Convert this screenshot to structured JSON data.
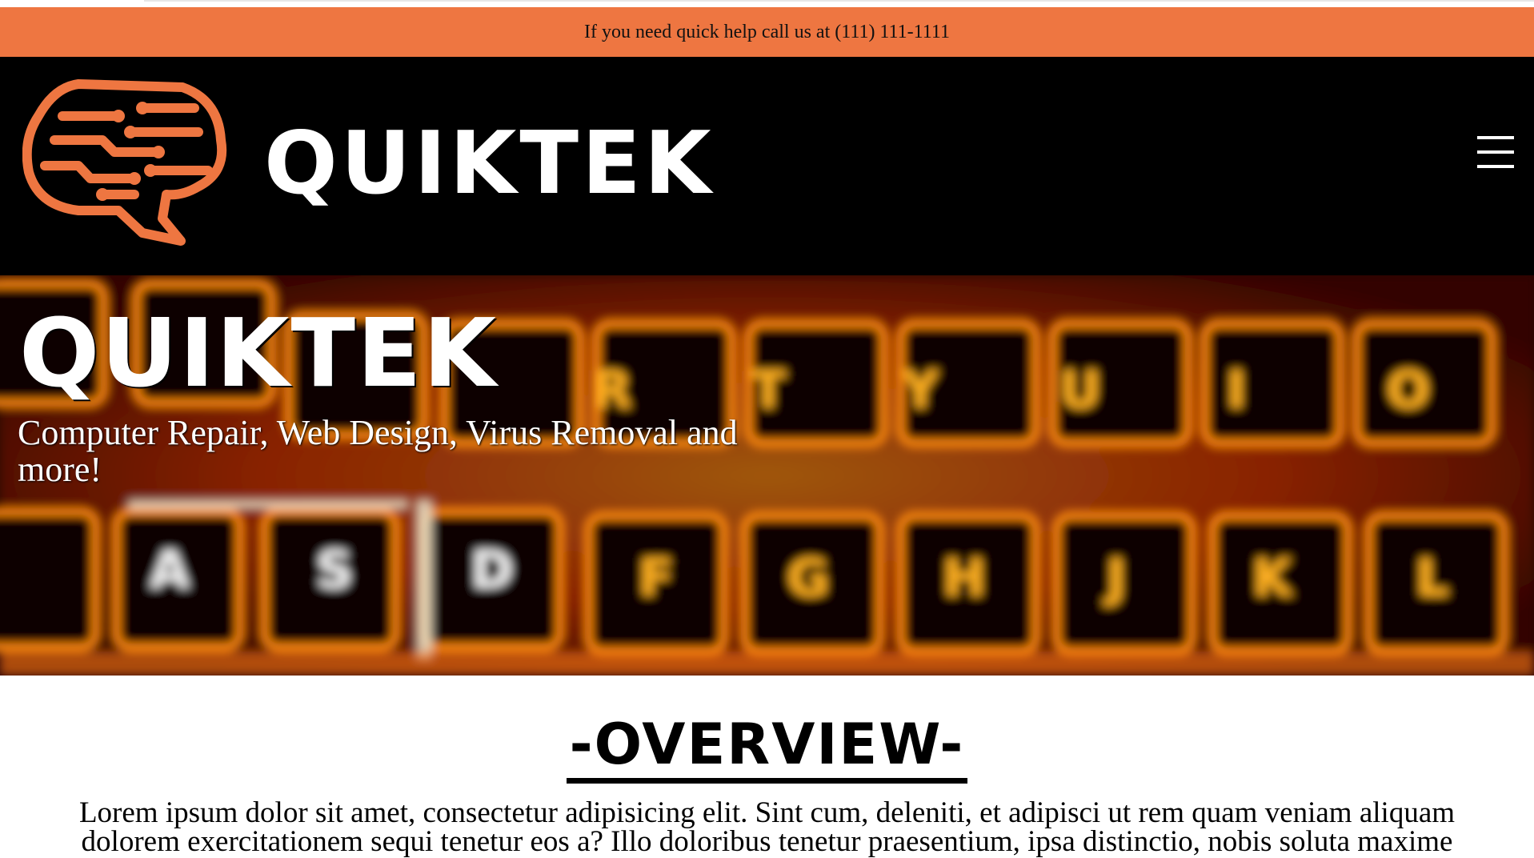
{
  "announcement": {
    "text": "If you need quick help call us at (111) 111-1111"
  },
  "header": {
    "logo_icon": "brain-circuit-icon",
    "wordmark": "QUIKTEK",
    "menu_icon": "hamburger-menu-icon",
    "accent_color": "#ee7641",
    "background_color": "#000000"
  },
  "hero": {
    "title": "QUIKTEK",
    "tagline": "Computer Repair, Web Design, Virus Removal and more!",
    "background": "glowing-keyboard-image"
  },
  "overview": {
    "heading": "-OVERVIEW-",
    "body": "Lorem ipsum dolor sit amet, consectetur adipisicing elit. Sint cum, deleniti, et adipisci ut rem quam veniam aliquam dolorem exercitationem sequi tenetur eos a? Illo doloribus tenetur praesentium, ipsa distinctio, nobis soluta maxime"
  }
}
